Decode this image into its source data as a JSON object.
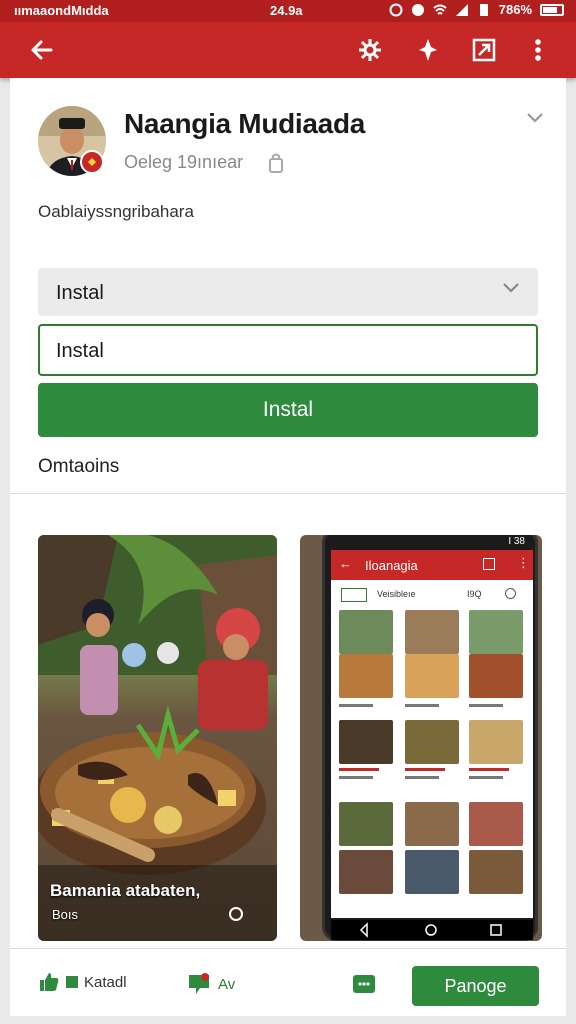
{
  "status_bar": {
    "left_text": "ıımaaondMıdda",
    "time": "24.9a",
    "battery_text": "786%"
  },
  "toolbar": {
    "back_icon": "arrow-left-icon",
    "icons": [
      "settings-icon",
      "pin-icon",
      "open-external-icon",
      "more-vert-icon"
    ]
  },
  "app": {
    "title": "Naangia Mudiaada",
    "subtitle": "Oeleg 19ınıear",
    "description": "Oablaiyssngribahara"
  },
  "install": {
    "select_value": "Instal",
    "input_value": "Instal",
    "button_label": "Instal"
  },
  "section": {
    "title": "Omtaoins"
  },
  "screenshots": {
    "first_caption": "Bamania atabaten,",
    "first_sub": "Boıs",
    "phone_title": "Iloanagia",
    "phone_status": "I 38",
    "phone_tab_mid": "Veisibleıe",
    "phone_tab_right": "I9Q"
  },
  "bottom_bar": {
    "like_label": "Katadl",
    "chat_label": "Av",
    "manage_label": "Panoge"
  },
  "colors": {
    "brand_red": "#c62828",
    "accent_green": "#2e8b3e"
  }
}
